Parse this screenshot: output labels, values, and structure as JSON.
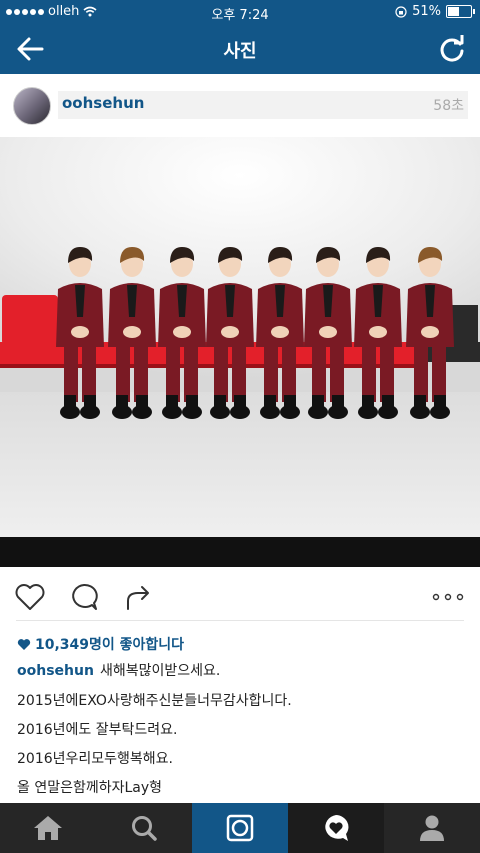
{
  "status": {
    "carrier": "olleh",
    "time": "오후 7:24",
    "battery": "51%",
    "battery_level": 0.51
  },
  "nav": {
    "title": "사진",
    "back_icon": "arrow-left-icon",
    "refresh_icon": "refresh-icon"
  },
  "post": {
    "username": "oohsehun",
    "time_ago": "58초",
    "likes": "10,349명이 좋아합니다",
    "caption": {
      "user": "oohsehun",
      "first_line": "새해복많이받으세요.",
      "lines": [
        "2015년에EXO사랑해주신분들너무감사합니다.",
        "2016년에도 잘부탁드려요.",
        "2016년우리모두행복해요.",
        "올 연말은함께하자Lay형"
      ]
    }
  },
  "actions": [
    "heart-icon",
    "comment-icon",
    "share-icon",
    "more-icon"
  ],
  "tabs": [
    {
      "name": "home",
      "icon": "home-icon",
      "active": false
    },
    {
      "name": "search",
      "icon": "search-icon",
      "active": false
    },
    {
      "name": "camera",
      "icon": "camera-icon",
      "active": true
    },
    {
      "name": "activity",
      "icon": "heart-bubble-icon",
      "active": false
    },
    {
      "name": "profile",
      "icon": "profile-icon",
      "active": false
    }
  ],
  "colors": {
    "brand": "#125688",
    "tabbar": "#262626",
    "chair": "#e3202a",
    "suit": "#7a1a24"
  }
}
